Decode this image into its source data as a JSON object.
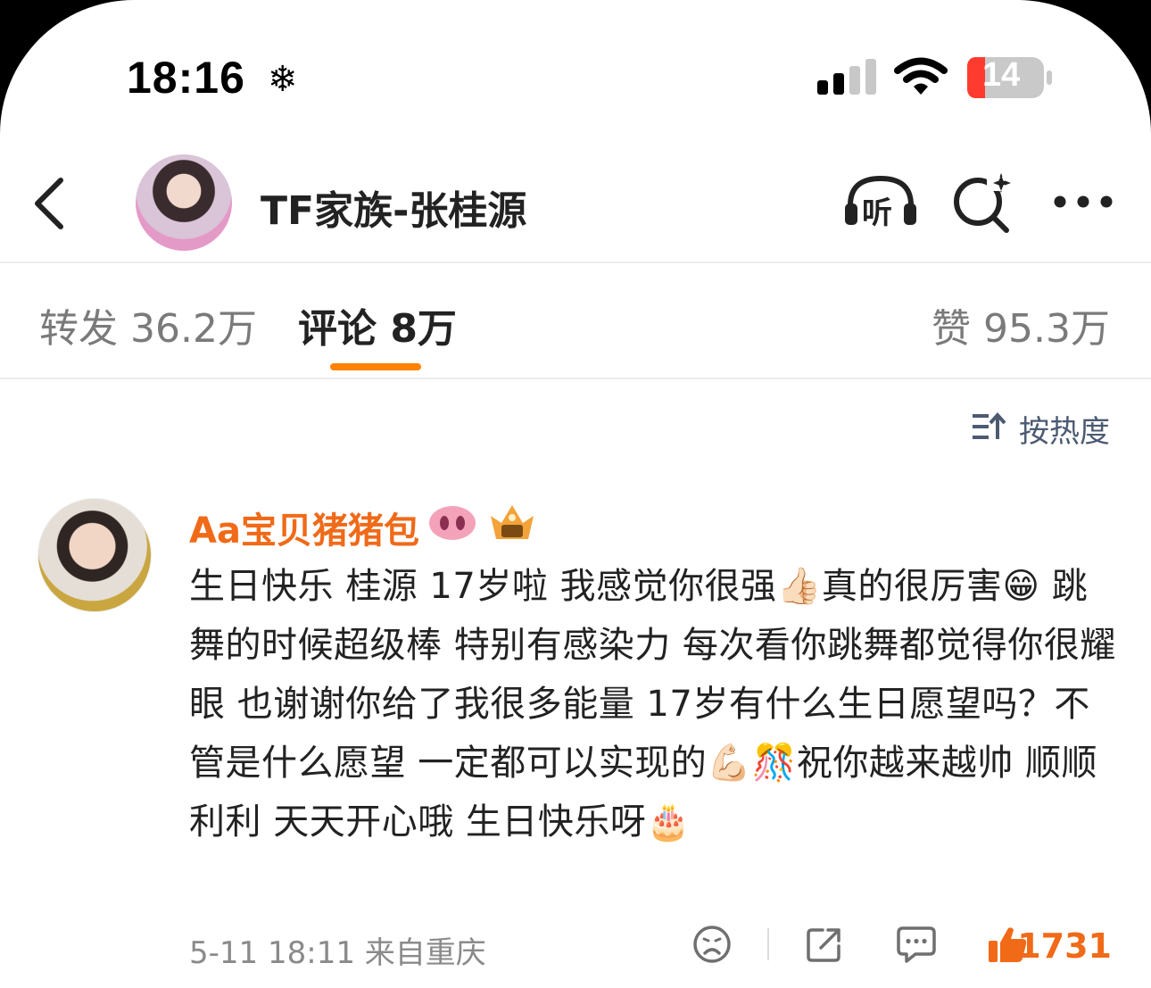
{
  "status_bar": {
    "time": "18:16",
    "battery": "14",
    "accent_low_battery": "#ff3b30"
  },
  "header": {
    "title": "TF家族-张桂源",
    "listen_label": "听"
  },
  "tabs": {
    "repost": "转发 36.2万",
    "comment": "评论 8万",
    "like": "赞 95.3万",
    "active_color": "#ff8200"
  },
  "sort": {
    "label": "按热度"
  },
  "comment": {
    "username": "Aa宝贝猪猪包",
    "text": "生日快乐 桂源 17岁啦 我感觉你很强👍🏻真的很厉害😁 跳舞的时候超级棒 特别有感染力 每次看你跳舞都觉得你很耀眼 也谢谢你给了我很多能量 17岁有什么生日愿望吗？不管是什么愿望 一定都可以实现的💪🏻🎊祝你越来越帅 顺顺利利 天天开心哦 生日快乐呀🎂",
    "meta": "5-11 18:11  来自重庆",
    "likes": "1731"
  },
  "icons": {
    "back": "chevron-left-icon",
    "search": "search-sparkle-icon",
    "more": "more-dots-icon",
    "sort": "sort-icon",
    "dislike": "frown-face-icon",
    "share": "share-icon",
    "reply": "comment-bubble-icon",
    "like": "thumbs-up-icon"
  }
}
